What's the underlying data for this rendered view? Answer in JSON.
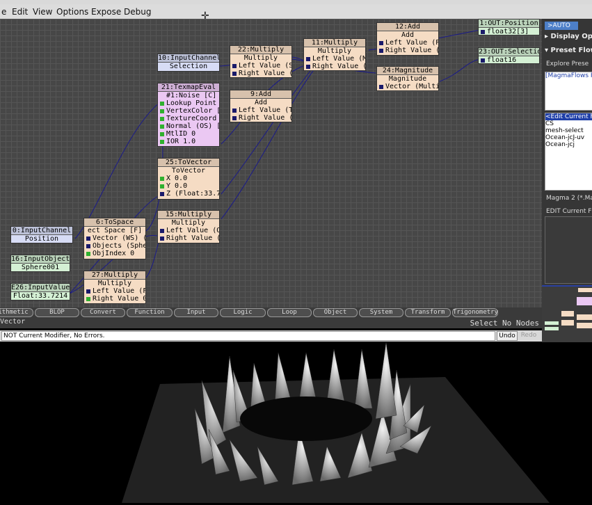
{
  "menu": [
    "e",
    "Edit",
    "View",
    "Options",
    "Expose",
    "Debug"
  ],
  "nodes": {
    "input_channel_10": {
      "title": "10:InputChannel",
      "rows": [
        "Selection"
      ]
    },
    "multiply_22": {
      "title": "22:Multiply",
      "sub": "Multiply",
      "rows": [
        "Left Value (Sel",
        "Right Value (Mag"
      ]
    },
    "multiply_11": {
      "title": "11:Multiply",
      "sub": "Multiply",
      "rows": [
        "Left Value (Mul",
        "Right Value (Ad"
      ]
    },
    "add_12": {
      "title": "12:Add",
      "sub": "Add",
      "rows": [
        "Left Value (Pos",
        "Right Value (Mu"
      ]
    },
    "magnitude_24": {
      "title": "24:Magnitude",
      "sub": "Magnitude",
      "rows": [
        "Vector (Multipl"
      ]
    },
    "out_position_1": {
      "title": "1:OUT:Position",
      "rows": [
        "float32[3]"
      ]
    },
    "out_selection_23": {
      "title": "23:OUT:Selection",
      "rows": [
        "float16"
      ]
    },
    "texmap_21": {
      "title": "21:TexmapEval",
      "rows": [
        "#1:Noise [C]",
        "Lookup Point (O",
        "VertexColor [0,",
        "TextureCoord [0",
        "Normal (OS) [0,",
        "MtlID 0",
        "IOR 1.0"
      ]
    },
    "add_9": {
      "title": "9:Add",
      "sub": "Add",
      "rows": [
        "Left Value (ToV",
        "Right Value (Mu"
      ]
    },
    "tovector_25": {
      "title": "25:ToVector",
      "sub": "ToVector",
      "rows": [
        "X 0.0",
        "Y 0.0",
        "Z (Float:33.721"
      ]
    },
    "multiply_15": {
      "title": "15:Multiply",
      "sub": "Multiply",
      "rows": [
        "Left Value (Obj",
        "Right Value (Mu"
      ]
    },
    "tospace_6": {
      "title": "6:ToSpace",
      "sub": "ect Space [F]",
      "rows": [
        "Vector (WS) (Po",
        "Objects (Sphere",
        "ObjIndex 0"
      ]
    },
    "input_channel_0": {
      "title": "0:InputChannel",
      "rows": [
        "Position"
      ]
    },
    "input_object_16": {
      "title": "16:InputObject",
      "rows": [
        "Sphere001"
      ]
    },
    "input_value_26": {
      "title": "E26:InputValue",
      "rows": [
        "Float:33.7214"
      ]
    },
    "multiply_27": {
      "title": "27:Multiply",
      "sub": "Multiply",
      "rows": [
        "Left Value (Flo",
        "Right Value 0.0"
      ]
    }
  },
  "tabs": [
    "ithmetic",
    "BLOP",
    "Convert",
    "Function",
    "Input",
    "Logic",
    "Loop",
    "Object",
    "System",
    "Transform",
    "Trigonometry"
  ],
  "vector_tab": "Vector",
  "select_status": "Select No Nodes",
  "status": "NOT Current Modifier, No Errors.",
  "undo": "Undo",
  "redo": "Redo",
  "right_panel": {
    "auto": ">AUTO",
    "display_options": "Display Opti",
    "preset_flows": "Preset Flows",
    "explore_presets": "Explore Prese",
    "list1": [
      "[MagmaFlows Ro"
    ],
    "list2": [
      "<Edit Current Fl",
      "CS",
      "mesh-select",
      "Ocean-jcJ-uv",
      "Ocean-jcj"
    ],
    "magma_label": "Magma 2 (*.Mag",
    "edit_current": "EDIT Current Flo"
  },
  "colors": {
    "canvas": "#474747",
    "wire": "#1a1a8a",
    "node_tan": "#f5dcc4",
    "node_blue": "#d7dcf5",
    "node_green": "#d4f0d4",
    "node_pink": "#ebc8f3",
    "accent": "#4d7fc8"
  }
}
